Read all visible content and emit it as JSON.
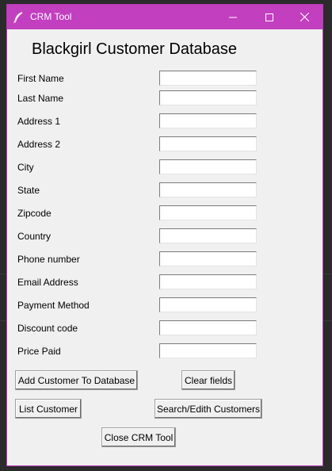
{
  "window": {
    "title": "CRM Tool",
    "accent_color": "#c23fc0"
  },
  "heading": "Blackgirl Customer Database",
  "fields": [
    {
      "label": "First Name",
      "value": ""
    },
    {
      "label": "Last Name",
      "value": ""
    },
    {
      "label": "Address 1",
      "value": ""
    },
    {
      "label": "Address 2",
      "value": ""
    },
    {
      "label": "City",
      "value": ""
    },
    {
      "label": "State",
      "value": ""
    },
    {
      "label": "Zipcode",
      "value": ""
    },
    {
      "label": "Country",
      "value": ""
    },
    {
      "label": "Phone number",
      "value": ""
    },
    {
      "label": "Email Address",
      "value": ""
    },
    {
      "label": "Payment Method",
      "value": ""
    },
    {
      "label": "Discount code",
      "value": ""
    },
    {
      "label": "Price Paid",
      "value": ""
    }
  ],
  "buttons": {
    "add_customer": "Add Customer To Database",
    "clear_fields": "Clear fields",
    "list_customer": "List Customer",
    "search_edit": "Search/Edith Customers",
    "close_tool": "Close CRM Tool"
  },
  "icons": {
    "app": "feather-icon",
    "minimize": "minimize-icon",
    "maximize": "maximize-icon",
    "close": "close-icon"
  }
}
